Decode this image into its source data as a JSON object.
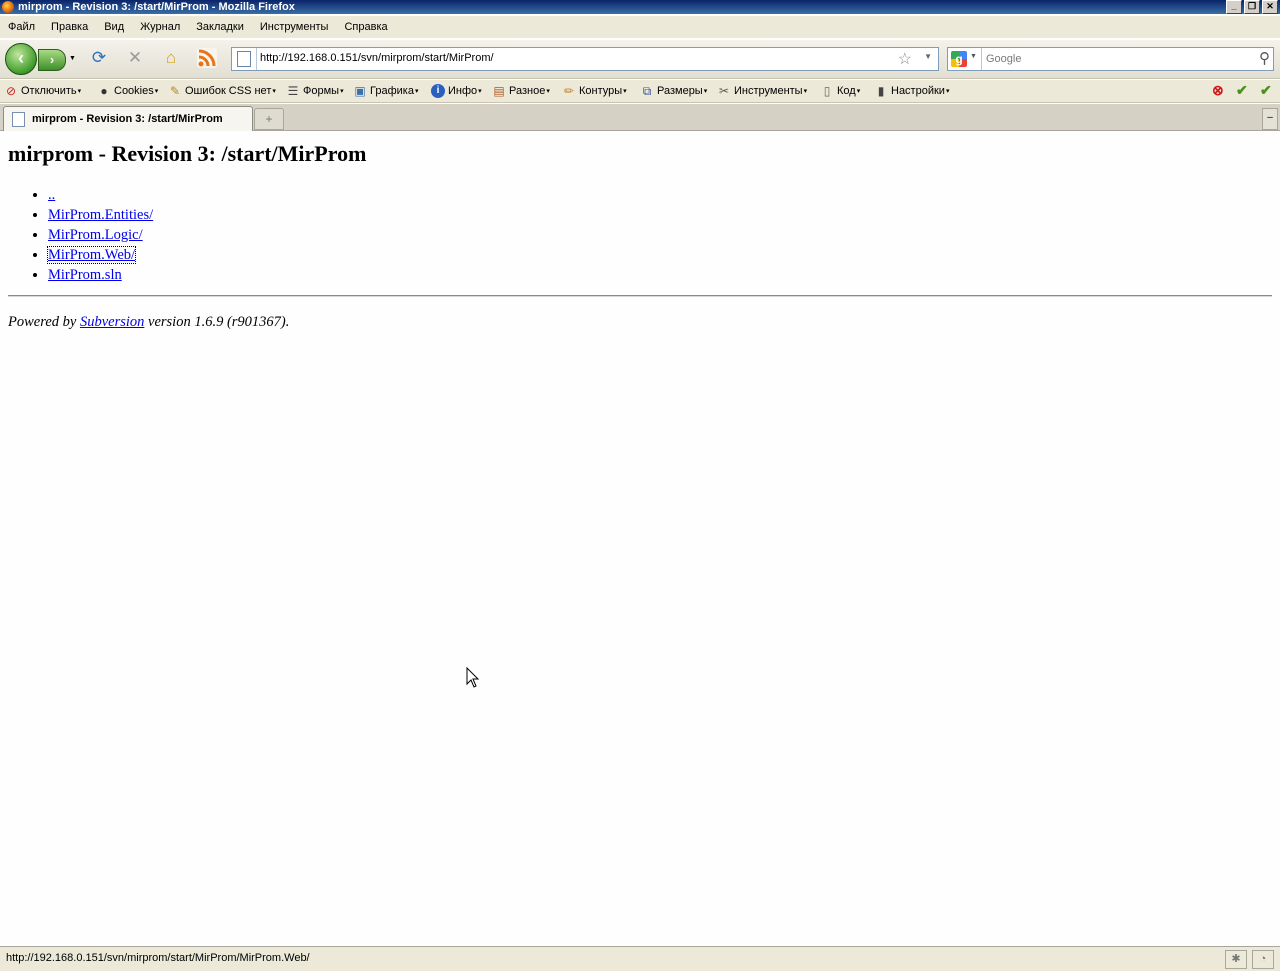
{
  "window": {
    "title": "mirprom - Revision 3: /start/MirProm - Mozilla Firefox",
    "controls": {
      "minimize": "_",
      "restore": "❐",
      "close": "✕"
    }
  },
  "menubar": {
    "items": [
      "Файл",
      "Правка",
      "Вид",
      "Журнал",
      "Закладки",
      "Инструменты",
      "Справка"
    ]
  },
  "navigation": {
    "url": "http://192.168.0.151/svn/mirprom/start/MirProm/",
    "search_placeholder": "Google",
    "icons": [
      "back-icon",
      "forward-icon",
      "reload-icon",
      "stop-icon",
      "home-icon",
      "rss-icon",
      "bookmark-star-icon",
      "search-magnifier-icon"
    ]
  },
  "devbar": {
    "items": [
      {
        "label": "Отключить",
        "icon": "disable-icon",
        "color": "#cc2222"
      },
      {
        "label": "Cookies",
        "icon": "user-icon",
        "color": "#333333"
      },
      {
        "label": "Ошибок CSS нет",
        "icon": "pencil-icon",
        "color": "#b08a2a"
      },
      {
        "label": "Формы",
        "icon": "forms-icon",
        "color": "#444444"
      },
      {
        "label": "Графика",
        "icon": "image-icon",
        "color": "#3a6fb0"
      },
      {
        "label": "Инфо",
        "icon": "info-icon",
        "color": "#2a5fc0"
      },
      {
        "label": "Разное",
        "icon": "misc-icon",
        "color": "#b05a20"
      },
      {
        "label": "Контуры",
        "icon": "outline-pencil-icon",
        "color": "#c08020"
      },
      {
        "label": "Размеры",
        "icon": "resize-icon",
        "color": "#335599"
      },
      {
        "label": "Инструменты",
        "icon": "tools-icon",
        "color": "#555555"
      },
      {
        "label": "Код",
        "icon": "code-icon",
        "color": "#666666"
      },
      {
        "label": "Настройки",
        "icon": "settings-icon",
        "color": "#444444"
      }
    ],
    "status_icons": [
      {
        "name": "error-status-icon",
        "glyph": "⊗",
        "color": "#d01818"
      },
      {
        "name": "css-valid-icon",
        "glyph": "✔",
        "color": "#4a8f1a"
      },
      {
        "name": "html-valid-icon",
        "glyph": "✔",
        "color": "#4a8f1a"
      }
    ]
  },
  "tabs": {
    "active_label": "mirprom - Revision 3: /start/MirProm",
    "new_tab": "+",
    "list_tabs": "–"
  },
  "page": {
    "heading": "mirprom - Revision 3: /start/MirProm",
    "links": [
      "..",
      "MirProm.Entities/",
      "MirProm.Logic/",
      "MirProm.Web/",
      "MirProm.sln"
    ],
    "focused_link_index": 3,
    "footer_prefix": "Powered by ",
    "footer_link": "Subversion",
    "footer_suffix": " version 1.6.9 (r901367)."
  },
  "statusbar": {
    "text": "http://192.168.0.151/svn/mirprom/start/MirProm/MirProm.Web/"
  }
}
